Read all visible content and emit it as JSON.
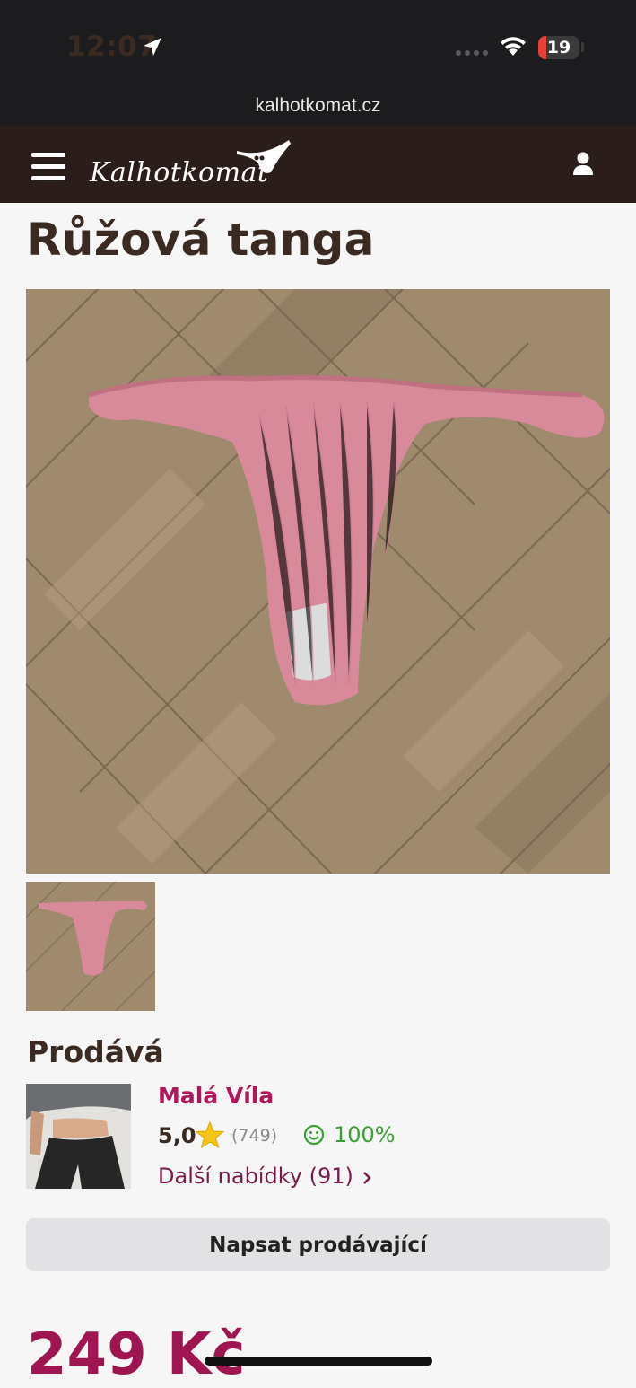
{
  "status_bar": {
    "time": "12:07",
    "battery_level": "19",
    "battery_fraction": 0.19,
    "location_icon": "location-arrow-icon",
    "wifi_icon": "wifi-icon"
  },
  "browser": {
    "url": "kalhotkomat.cz"
  },
  "header": {
    "logo_text": "Kalhotkomat",
    "menu_icon": "hamburger-icon",
    "account_icon": "user-icon",
    "background": "#2b1d1a"
  },
  "product": {
    "title": "Růžová tanga",
    "price": "249 Kč",
    "main_image": "photo of pink ribbed thong on parquet floor",
    "thumbnail": "thumbnail of pink thong"
  },
  "seller": {
    "heading": "Prodává",
    "name": "Malá Víla",
    "rating": "5,0",
    "review_count": "(749)",
    "satisfaction": "100%",
    "more_offers": "Další nabídky (91)",
    "message_button": "Napsat prodávající"
  },
  "colors": {
    "accent": "#b0185e",
    "price": "#9e1552",
    "positive": "#3aa035",
    "title": "#3b2a22"
  }
}
